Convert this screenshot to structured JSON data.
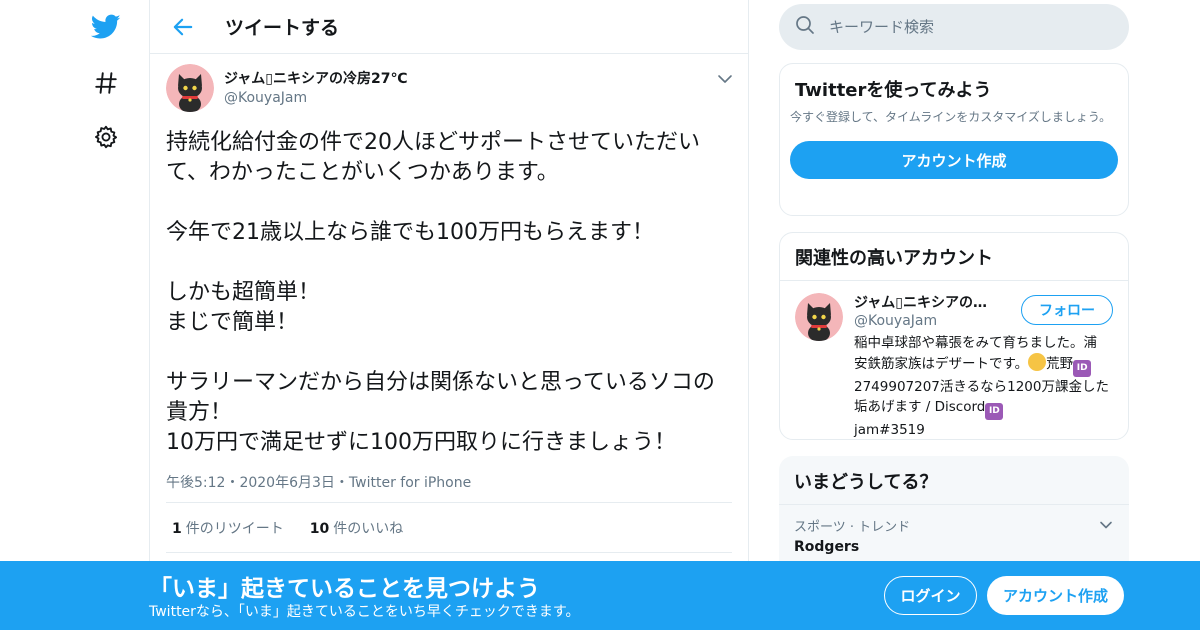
{
  "colors": {
    "accent": "#1da1f2",
    "text": "#14171a",
    "secondary": "#657786",
    "border": "#e6ecf0"
  },
  "nav": {
    "icons": [
      "twitter-bird-icon",
      "hashtag-icon",
      "gear-icon"
    ]
  },
  "header": {
    "title": "ツイートする",
    "back_icon": "arrow-left-icon"
  },
  "tweet": {
    "display_name": "ジャム▯ニキシアの冷房27℃",
    "handle": "@KouyaJam",
    "text": "持続化給付金の件で20人ほどサポートさせていただいて、わかったことがいくつかあります。\n\n今年で21歳以上なら誰でも100万円もらえます！\n\nしかも超簡単！\nまじで簡単！\n\nサラリーマンだから自分は関係ないと思っているソコの貴方！\n10万円で満足せずに100万円取りに行きましょう！",
    "time": "午後5:12",
    "date": "2020年6月3日",
    "source": "Twitter for iPhone",
    "separator": "・",
    "retweet_count": "1",
    "retweet_label": "件のリツイート",
    "like_count": "10",
    "like_label": "件のいいね"
  },
  "search": {
    "placeholder": "キーワード検索"
  },
  "signup_card": {
    "title": "Twitterを使ってみよう",
    "desc": "今すぐ登録して、タイムラインをカスタマイズしましょう。",
    "button": "アカウント作成"
  },
  "related": {
    "title": "関連性の高いアカウント",
    "name": "ジャム▯ニキシアの…",
    "handle": "@KouyaJam",
    "follow": "フォロー",
    "bio_1": "稲中卓球部や幕張をみて育ちました。浦安鉄筋家族はデザートです。",
    "bio_2": "荒野",
    "bio_id": "ID",
    "bio_3": "2749907207活きるなら1200万課金した垢あげます / Discord",
    "bio_4": "jam#3519"
  },
  "trends": {
    "title": "いまどうしてる？",
    "category": "スポーツ · トレンド",
    "name": "Rodgers"
  },
  "banner": {
    "title": "「いま」起きていることを見つけよう",
    "subtitle": "Twitterなら、「いま」起きていることをいち早くチェックできます。",
    "login": "ログイン",
    "signup": "アカウント作成"
  }
}
